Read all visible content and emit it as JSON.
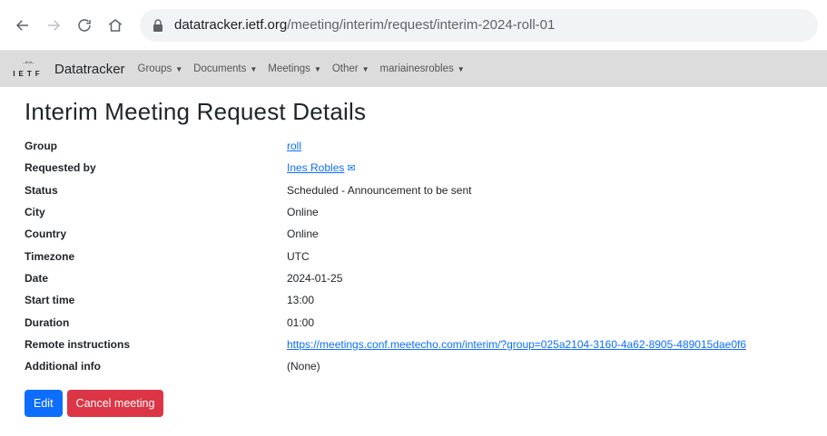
{
  "browser": {
    "url_host": "datatracker.ietf.org",
    "url_path": "/meeting/interim/request/interim-2024-roll-01"
  },
  "navbar": {
    "logo_text": "IETF",
    "brand": "Datatracker",
    "menu": [
      "Groups",
      "Documents",
      "Meetings",
      "Other",
      "mariainesrobles"
    ]
  },
  "page": {
    "title": "Interim Meeting Request Details"
  },
  "details": {
    "group": {
      "label": "Group",
      "value": "roll"
    },
    "requested_by": {
      "label": "Requested by",
      "value": "Ines Robles"
    },
    "status": {
      "label": "Status",
      "value": "Scheduled - Announcement to be sent"
    },
    "city": {
      "label": "City",
      "value": "Online"
    },
    "country": {
      "label": "Country",
      "value": "Online"
    },
    "timezone": {
      "label": "Timezone",
      "value": "UTC"
    },
    "date": {
      "label": "Date",
      "value": "2024-01-25"
    },
    "start_time": {
      "label": "Start time",
      "value": "13:00"
    },
    "duration": {
      "label": "Duration",
      "value": "01:00"
    },
    "remote_instructions": {
      "label": "Remote instructions",
      "value": "https://meetings.conf.meetecho.com/interim/?group=025a2104-3160-4a62-8905-489015dae0f6"
    },
    "additional_info": {
      "label": "Additional info",
      "value": "(None)"
    }
  },
  "actions": {
    "edit_label": "Edit",
    "cancel_label": "Cancel meeting"
  },
  "colors": {
    "primary": "#0d6efd",
    "danger": "#dc3545",
    "navbar_bg": "#dcdcdc"
  }
}
